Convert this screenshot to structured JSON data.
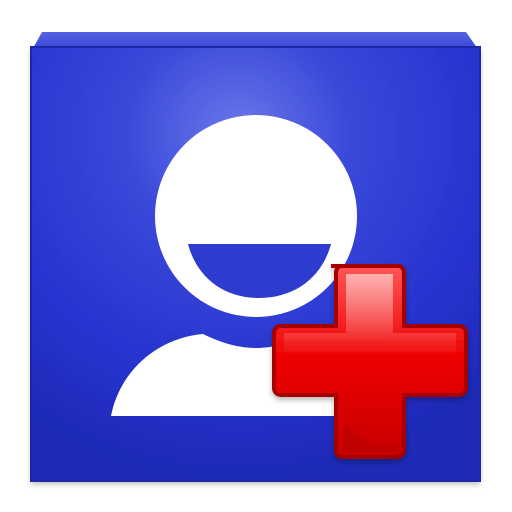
{
  "app_icon": {
    "name": "add-contact-app-icon",
    "tile_icon": "square-tile",
    "person_icon": "smiling-person-icon",
    "plus_icon": "plus-icon",
    "colors": {
      "tile_center": "#5c6be4",
      "tile_mid": "#2a3bd3",
      "tile_edge": "#1f28b8",
      "person": "#ffffff",
      "plus_light": "#ff4a4a",
      "plus_base": "#ee0000",
      "plus_dark": "#c10000",
      "plus_outline": "#a40000"
    }
  }
}
